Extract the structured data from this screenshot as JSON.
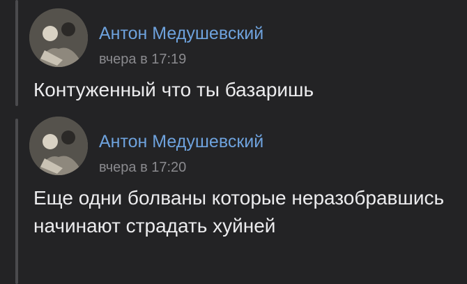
{
  "comments": [
    {
      "author": "Антон Медушевский",
      "time": "вчера в 17:19",
      "text": "Контуженный что ты базаришь"
    },
    {
      "author": "Антон Медушевский",
      "time": "вчера в 17:20",
      "text": "Еще одни болваны которые неразобравшись начинают страдать хуйней"
    }
  ],
  "colors": {
    "background": "#232325",
    "author": "#6ea2dd",
    "time": "#8a8a8e",
    "text": "#ececee",
    "thread_line": "#4a4a4d"
  }
}
